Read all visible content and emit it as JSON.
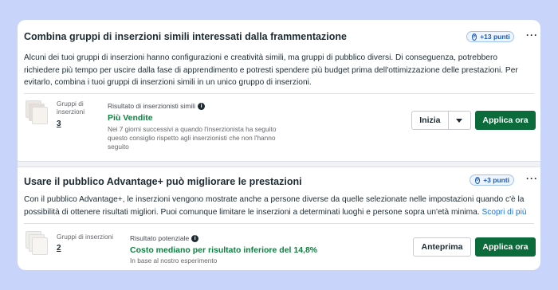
{
  "cards": [
    {
      "title": "Combina gruppi di inserzioni simili interessati dalla frammentazione",
      "points": "+13 punti",
      "more": "···",
      "description": "Alcuni dei tuoi gruppi di inserzioni hanno configurazioni e creatività simili, ma gruppi di pubblico diversi. Di conseguenza, potrebbero richiedere più tempo per uscire dalla fase di apprendimento e potresti spendere più budget prima dell'ottimizzazione delle prestazioni. Per evitarlo, combina i tuoi gruppi di inserzioni simili in un unico gruppo di inserzioni.",
      "group_label": "Gruppi di inserzioni",
      "group_count": "3",
      "result_label": "Risultato di inserzionisti simili",
      "result_value": "Più Vendite",
      "result_sub": "Nei 7 giorni successivi a quando l'inserzionista ha seguito questo consiglio rispetto agli inserzionisti che non l'hanno seguito",
      "secondary_button": "Inizia",
      "primary_button": "Applica ora"
    },
    {
      "title": "Usare il pubblico Advantage+ può migliorare le prestazioni",
      "points": "+3 punti",
      "more": "···",
      "description": "Con il pubblico Advantage+, le inserzioni vengono mostrate anche a persone diverse da quelle selezionate nelle impostazioni quando c'è la possibilità di ottenere risultati migliori. Puoi comunque limitare le inserzioni a determinati luoghi e persone sopra un'età minima.",
      "learn_more": "Scopri di più",
      "group_label": "Gruppi di inserzioni",
      "group_count": "2",
      "result_label": "Risultato potenziale",
      "result_value": "Costo mediano per risultato inferiore del 14,8%",
      "result_sub": "In base al nostro esperimento",
      "secondary_button": "Anteprima",
      "primary_button": "Applica ora"
    }
  ],
  "colors": {
    "background": "#c9d4fb",
    "accent_green": "#0b6b3a",
    "result_green": "#0d7f3f",
    "link_blue": "#1b74e4"
  },
  "icons": [
    "info-icon",
    "points-icon",
    "more-icon",
    "chevron-down-icon",
    "ad-thumbnail"
  ]
}
